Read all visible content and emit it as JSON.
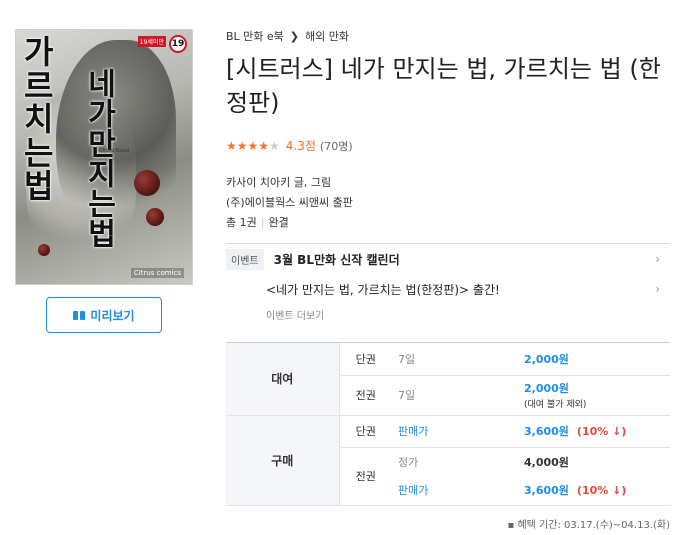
{
  "cover": {
    "title_vertical_left": "가르치는법",
    "title_vertical_right": "네가만지는법",
    "age_badge": "19",
    "age_label": "19세미만",
    "en_title": "Chiaki Kasai",
    "brand": "Citrus comics"
  },
  "preview_label": "미리보기",
  "breadcrumb": [
    "BL 만화 e북",
    "해외 만화"
  ],
  "title": "[시트러스] 네가 만지는 법, 가르치는 법 (한정판)",
  "rating": {
    "stars_filled": 4.3,
    "score": "4.3점",
    "count": "(70명)"
  },
  "author": "카사이 치아키 글, 그림",
  "publisher": "(주)에이블웍스 씨앤씨 출판",
  "volume_info": {
    "total": "총 1권",
    "status": "완결"
  },
  "events": {
    "tag": "이벤트",
    "items": [
      "3월 BL만화 신작 캘린더",
      "<네가 만지는 법, 가르치는 법(한정판)> 출간!"
    ],
    "more": "이벤트 더보기"
  },
  "price": {
    "rent_label": "대여",
    "buy_label": "구매",
    "single_label": "단권",
    "full_label": "전권",
    "rent_single": {
      "period": "7일",
      "amount": "2,000원"
    },
    "rent_full": {
      "period": "7일",
      "amount": "2,000원",
      "note": "(대여 불가 제외)"
    },
    "buy_single": {
      "label": "판매가",
      "amount": "3,600원",
      "discount": "(10% ↓)"
    },
    "buy_full_list": {
      "label": "정가",
      "amount": "4,000원"
    },
    "buy_full_sale": {
      "label": "판매가",
      "amount": "3,600원",
      "discount": "(10% ↓)"
    }
  },
  "benefit_period": "혜택 기간: 03.17.(수)~04.13.(화)"
}
